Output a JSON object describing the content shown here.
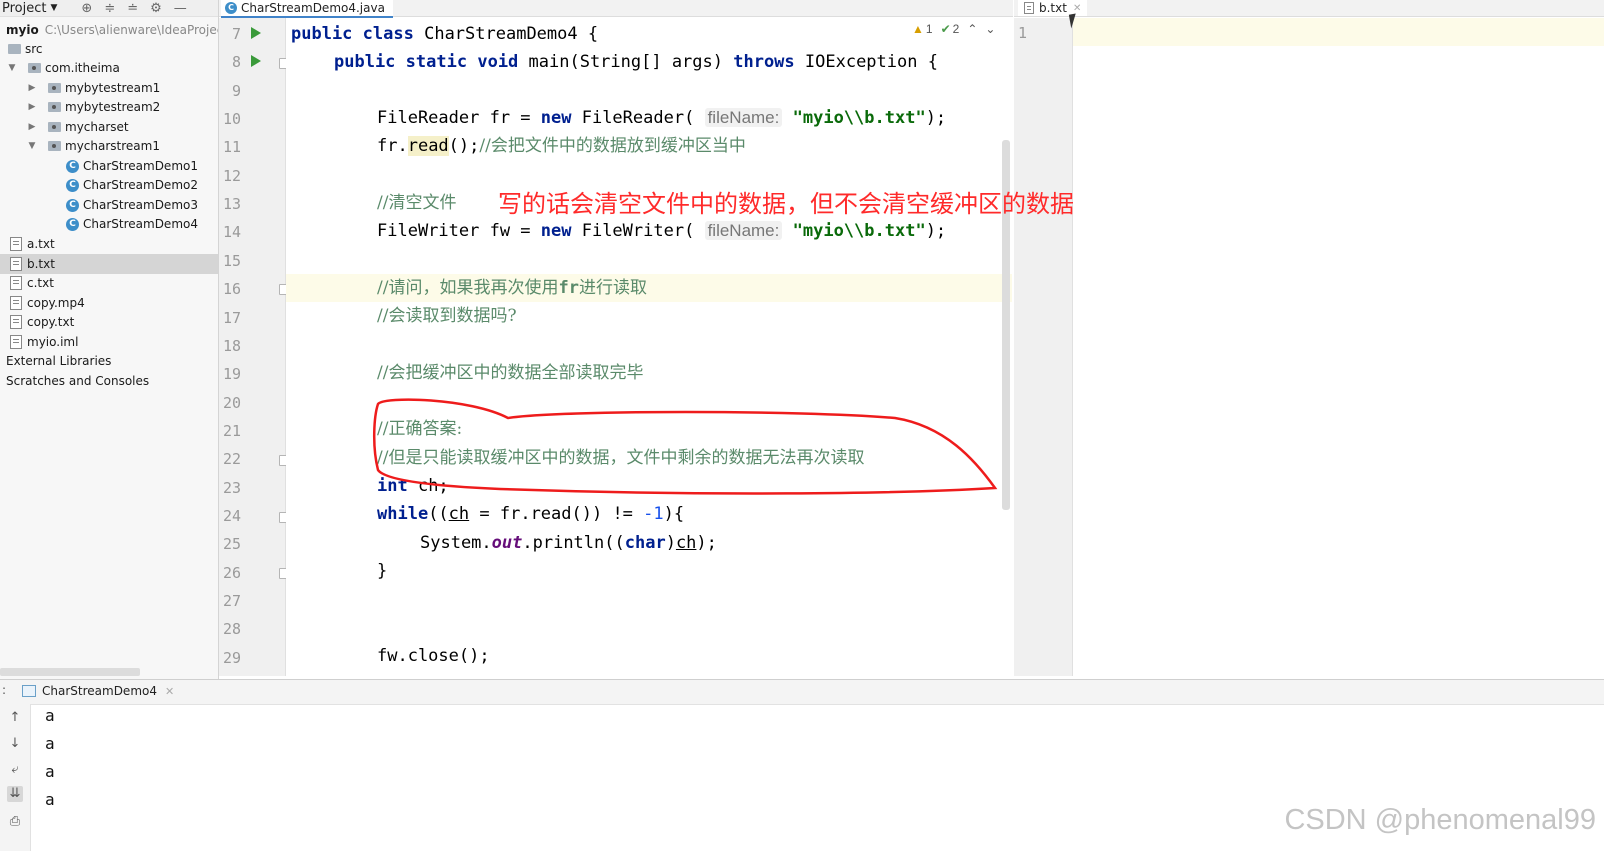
{
  "project": {
    "header_label": "Project",
    "root_name": "myio",
    "root_path": "C:\\Users\\alienware\\IdeaProjec",
    "src": "src",
    "package": "com.itheima",
    "packages": [
      "mybytestream1",
      "mybytestream2",
      "mycharset",
      "mycharstream1"
    ],
    "classes": [
      "CharStreamDemo1",
      "CharStreamDemo2",
      "CharStreamDemo3",
      "CharStreamDemo4"
    ],
    "files": [
      "a.txt",
      "b.txt",
      "c.txt",
      "copy.mp4",
      "copy.txt",
      "myio.iml"
    ],
    "selected_file": "b.txt",
    "external_libraries": "External Libraries",
    "scratches": "Scratches and Consoles"
  },
  "editor": {
    "tab_label": "CharStreamDemo4.java",
    "warnings": "1",
    "weak_warnings": "2",
    "line_numbers": [
      "7",
      "8",
      "9",
      "10",
      "11",
      "12",
      "13",
      "14",
      "15",
      "16",
      "17",
      "18",
      "19",
      "20",
      "21",
      "22",
      "23",
      "24",
      "25",
      "26",
      "27",
      "28",
      "29"
    ],
    "code": {
      "l7_kw1": "public",
      "l7_kw2": "class",
      "l7_rest": " CharStreamDemo4 {",
      "l8_kw1": "public",
      "l8_kw2": "static",
      "l8_kw3": "void",
      "l8_mid": " main(String[] args) ",
      "l8_kw4": "throws",
      "l8_rest": " IOException {",
      "l10_a": "FileReader fr = ",
      "l10_new": "new",
      "l10_b": " FileReader(",
      "l10_hint": "fileName:",
      "l10_str": "\"myio\\\\b.txt\"",
      "l10_end": ");",
      "l11_a": "fr.",
      "l11_read": "read",
      "l11_b": "();",
      "l11_cmt": "//会把文件中的数据放到缓冲区当中",
      "l13_cmt": "//清空文件",
      "l14_a": "FileWriter fw = ",
      "l14_new": "new",
      "l14_b": " FileWriter(",
      "l14_hint": "fileName:",
      "l14_str": "\"myio\\\\b.txt\"",
      "l14_end": ");",
      "l16_cmt_a": "//请问，如果我再次使用",
      "l16_cmt_fr": "fr",
      "l16_cmt_b": "进行读取",
      "l17_cmt": "//会读取到数据吗?",
      "l19_cmt": "//会把缓冲区中的数据全部读取完毕",
      "l21_cmt": "//正确答案:",
      "l22_cmt": "//但是只能读取缓冲区中的数据，文件中剩余的数据无法再次读取",
      "l23_kw": "int",
      "l23_rest": " ch;",
      "l24_kw": "while",
      "l24_a": "((",
      "l24_ch": "ch",
      "l24_b": " = fr.read()) != ",
      "l24_num": "-1",
      "l24_c": "){",
      "l25_a": "System.",
      "l25_out": "out",
      "l25_b": ".println((",
      "l25_kw": "char",
      "l25_c": ")",
      "l25_ch": "ch",
      "l25_d": ");",
      "l26": "}",
      "l29": "fw.close();"
    }
  },
  "annotation": "写的话会清空文件中的数据，但不会清空缓冲区的数据",
  "right_editor": {
    "tab_label": "b.txt",
    "line_number": "1"
  },
  "run": {
    "tab_label": "CharStreamDemo4",
    "output": [
      "a",
      "a",
      "a",
      "a"
    ]
  },
  "watermark": "CSDN @phenomenal99",
  "colors": {
    "accent": "#4083c9",
    "annotation_red": "#ff2a2a",
    "run_green": "#3a9a3a"
  }
}
